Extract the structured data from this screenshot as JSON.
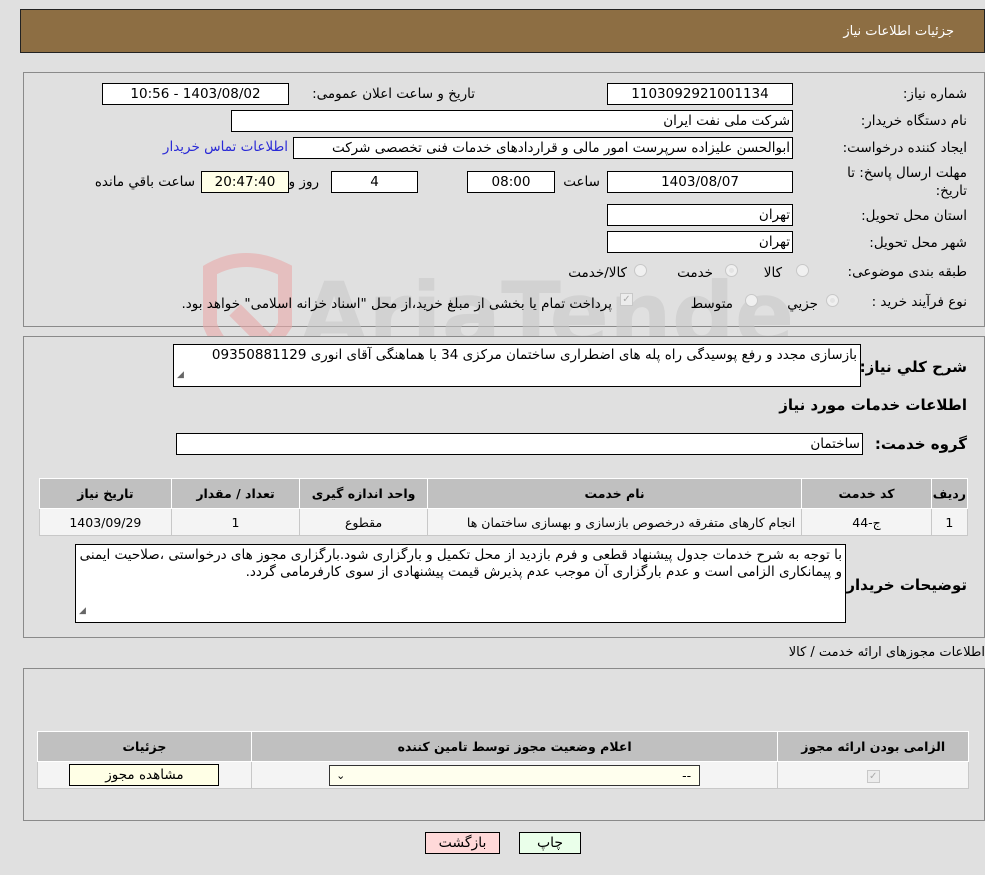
{
  "header": {
    "title": "جزئیات اطلاعات نیاز"
  },
  "info": {
    "need_number_label": "شماره نیاز:",
    "need_number": "1103092921001134",
    "announce_label": "تاریخ و ساعت اعلان عمومی:",
    "announce_value": "1403/08/02 - 10:56",
    "buyer_org_label": "نام دستگاه خریدار:",
    "buyer_org": "شرکت ملی نفت ایران",
    "creator_label": "ایجاد کننده درخواست:",
    "creator": "ابوالحسن علیزاده سرپرست امور مالی و قراردادهای خدمات فنی تخصصی شرکت",
    "buyer_contact_link": "اطلاعات تماس خریدار",
    "deadline_label_1": "مهلت ارسال پاسخ: تا",
    "deadline_label_2": "تاریخ:",
    "deadline_date": "1403/08/07",
    "time_label": "ساعت",
    "deadline_time": "08:00",
    "days_value": "4",
    "days_label": "روز و",
    "remaining_time": "20:47:40",
    "remaining_label": "ساعت باقي مانده",
    "province_label": "استان محل تحویل:",
    "province": "تهران",
    "city_label": "شهر محل تحویل:",
    "city": "تهران",
    "category_label": "طبقه بندی موضوعی:",
    "category_options": [
      {
        "label": "کالا",
        "selected": false
      },
      {
        "label": "خدمت",
        "selected": true
      },
      {
        "label": "کالا/خدمت",
        "selected": false
      }
    ],
    "process_label": "نوع فرآیند خرید :",
    "process_options": [
      {
        "label": "جزيي",
        "selected": true
      },
      {
        "label": "متوسط",
        "selected": false
      }
    ],
    "treasury_checkbox_checked": true,
    "treasury_note": "پرداخت تمام یا بخشی از مبلغ خرید،از محل \"اسناد خزانه اسلامی\" خواهد بود."
  },
  "description": {
    "label": "شرح کلي نياز:",
    "text": "بازسازی مجدد و رفع پوسیدگی راه پله های اضطراری ساختمان مرکزی 34 با هماهنگی آقای انوری 09350881129"
  },
  "services": {
    "section_title": "اطلاعات خدمات مورد نیاز",
    "group_label": "گروه خدمت:",
    "group_value": "ساختمان",
    "columns": [
      "ردیف",
      "کد خدمت",
      "نام خدمت",
      "واحد اندازه گیری",
      "تعداد / مقدار",
      "تاریخ نیاز"
    ],
    "rows": [
      [
        "1",
        "ج-44",
        "انجام کارهای متفرقه درخصوص بازسازی و بهسازی ساختمان ها",
        "مقطوع",
        "1",
        "1403/09/29"
      ]
    ]
  },
  "buyer_notes": {
    "label": "توضیحات خریدار:",
    "text": "با توجه به شرح خدمات جدول پیشنهاد قطعی و فرم بازدید از محل تکمیل و بارگزاری شود.بارگزاری مجوز های درخواستی ،صلاحیت ایمنی و پیمانکاری الزامی است و عدم بارگزاری آن موجب عدم پذیرش قیمت پیشنهادی  از سوی کارفرمامی گردد."
  },
  "permits": {
    "section_title": "اطلاعات مجوزهای ارائه خدمت / کالا",
    "columns": [
      "الزامی بودن ارائه مجوز",
      "اعلام وضعیت مجوز توسط تامین کننده",
      "جزئیات"
    ],
    "row": {
      "required_checked": true,
      "status_select_value": "--",
      "view_button": "مشاهده مجوز"
    }
  },
  "actions": {
    "print": "چاپ",
    "back": "بازگشت"
  },
  "colors": {
    "header_bg": "#8d6e43",
    "link": "#2a2ad6",
    "back_btn_bg": "#ffd9d9",
    "print_btn_bg": "#eaffea"
  }
}
